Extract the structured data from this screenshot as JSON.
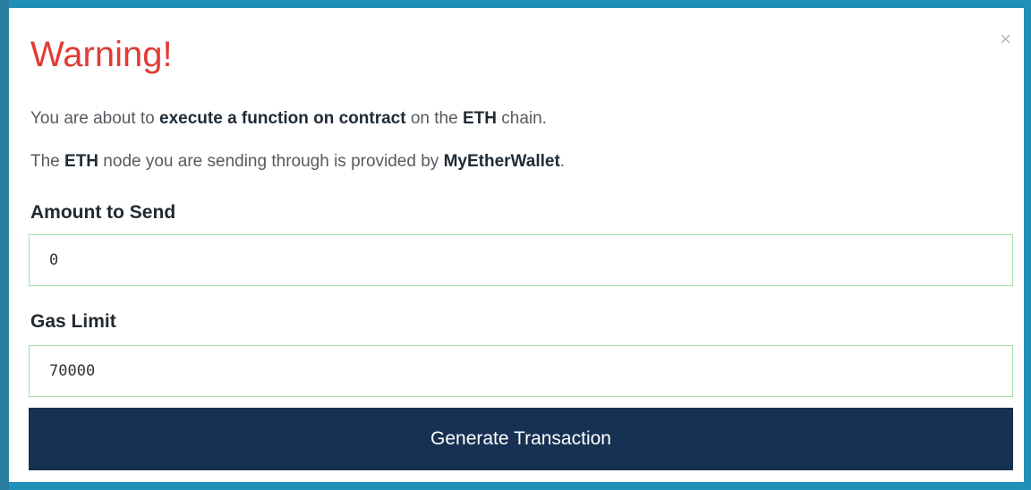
{
  "modal": {
    "close_glyph": "×",
    "title": "Warning!",
    "line1": {
      "p1": "You are about to ",
      "b1": "execute a function on contract",
      "p2": " on the ",
      "b2": "ETH",
      "p3": " chain."
    },
    "line2": {
      "p1": "The ",
      "b1": "ETH",
      "p2": " node you are sending through is provided by ",
      "b2": "MyEtherWallet",
      "p3": "."
    },
    "amount": {
      "label": "Amount to Send",
      "value": "0"
    },
    "gas": {
      "label": "Gas Limit",
      "value": "70000"
    },
    "generate_label": "Generate Transaction"
  },
  "colors": {
    "title": "#e03c36",
    "button_bg": "#163152",
    "input_border": "#9ee0aa",
    "backdrop": "#1f90b8"
  }
}
